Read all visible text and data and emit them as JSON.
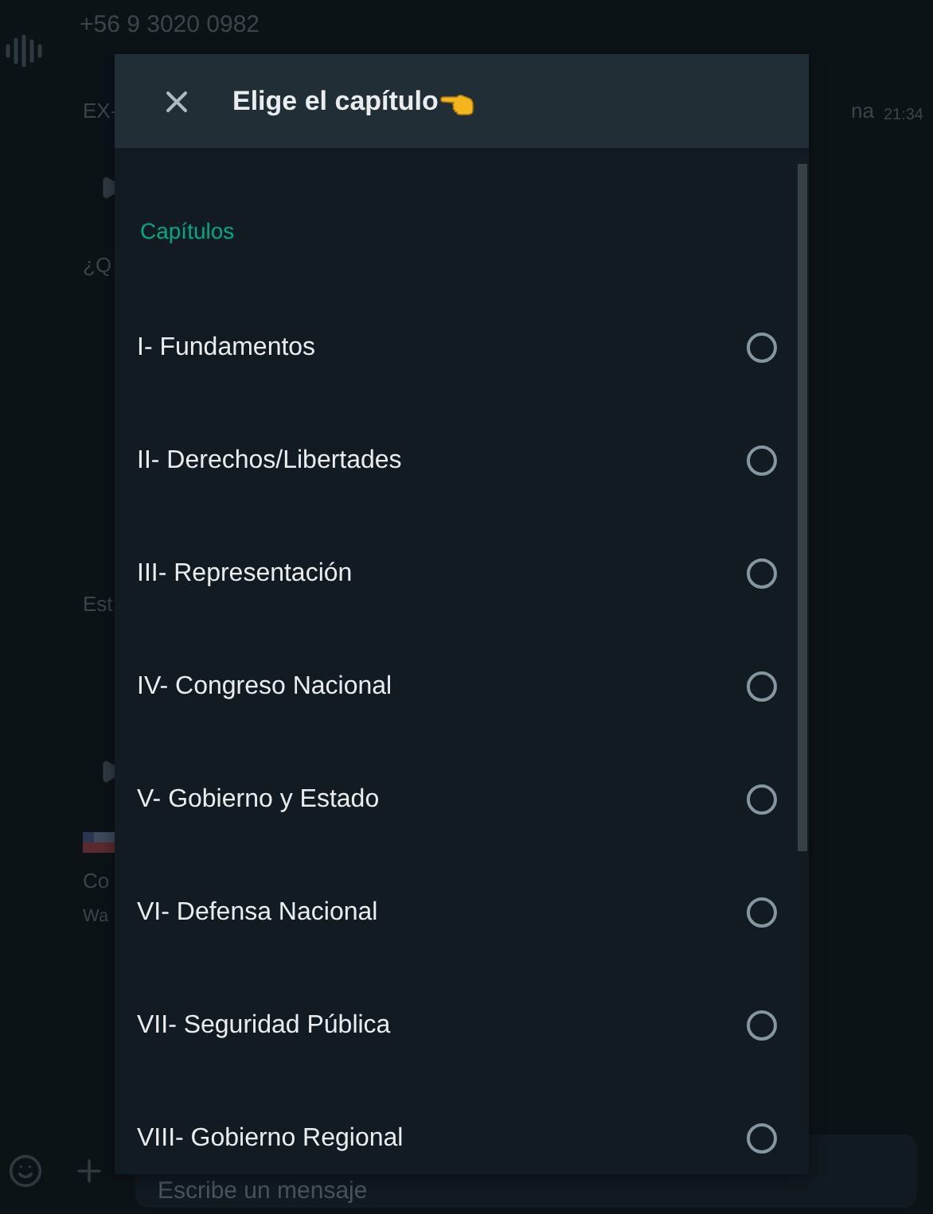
{
  "background": {
    "contact": "+56 9 3020 0982",
    "messages": [
      "EX-",
      "¿Q",
      "Est",
      "Co",
      "Wa"
    ],
    "side_text": "na",
    "time": "21:34",
    "composer": {
      "placeholder": "Escribe un mensaje"
    }
  },
  "dialog": {
    "title": "Elige el capítulo",
    "section": "Capítulos",
    "options": [
      {
        "label": "I- Fundamentos",
        "selected": false
      },
      {
        "label": "II- Derechos/Libertades",
        "selected": false
      },
      {
        "label": "III- Representación",
        "selected": false
      },
      {
        "label": "IV- Congreso Nacional",
        "selected": false
      },
      {
        "label": "V- Gobierno y Estado",
        "selected": false
      },
      {
        "label": "VI- Defensa Nacional",
        "selected": false
      },
      {
        "label": "VII- Seguridad Pública",
        "selected": false
      },
      {
        "label": "VIII- Gobierno Regional",
        "selected": false
      }
    ]
  }
}
